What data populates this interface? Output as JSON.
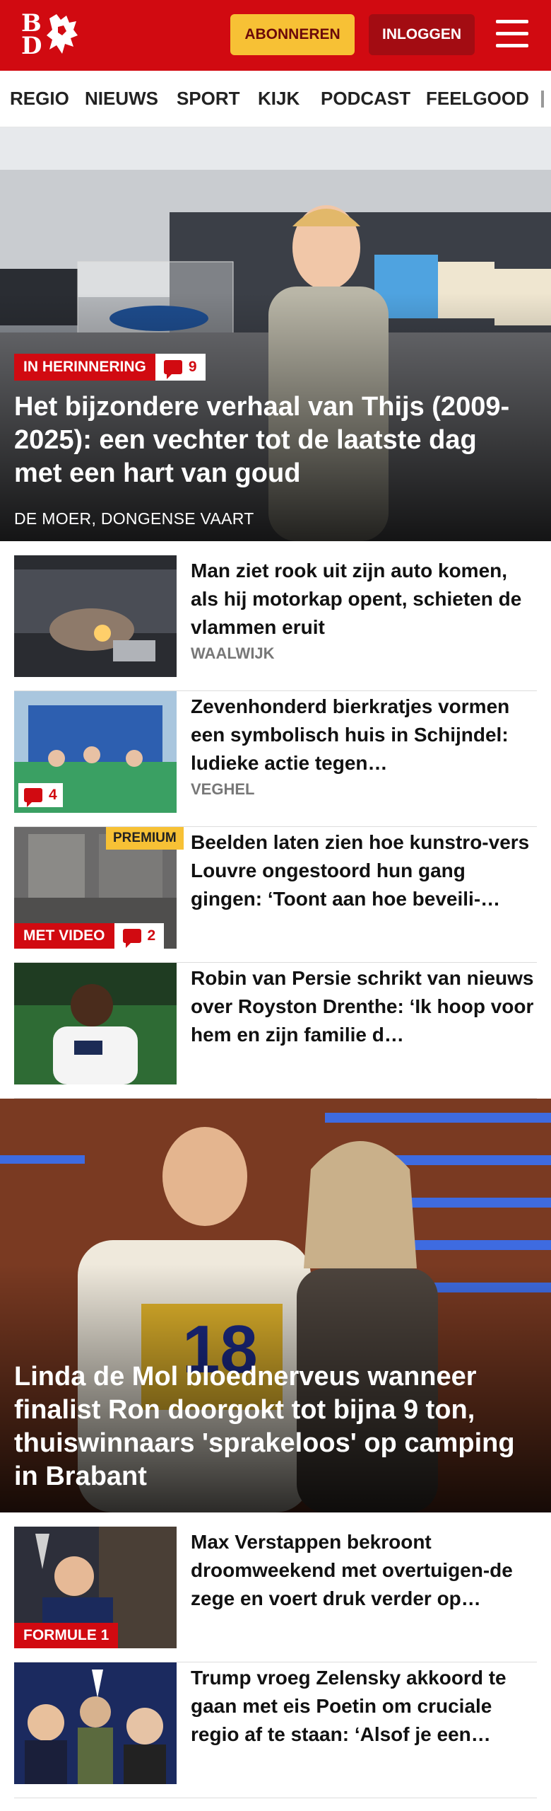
{
  "header": {
    "logo_top": "B",
    "logo_bottom": "D",
    "subscribe_label": "ABONNEREN",
    "login_label": "INLOGGEN"
  },
  "nav": {
    "items": [
      "REGIO",
      "NIEUWS",
      "SPORT",
      "KIJK",
      "PODCAST",
      "FEELGOOD"
    ]
  },
  "hero1": {
    "label": "IN HERINNERING",
    "comments": "9",
    "title": "Het bijzondere verhaal van Thijs (2009-2025): een vechter tot de laatste dag met een hart van goud",
    "location": "DE MOER, DONGENSE VAART"
  },
  "articles": [
    {
      "title": "Man ziet rook uit zijn auto komen, als hij motorkap opent, schieten de vlammen eruit",
      "location": "WAALWIJK"
    },
    {
      "title": "Zevenhonderd bierkratjes vormen een symbolisch huis in Schijndel: ludieke actie tegen…",
      "location": "VEGHEL",
      "comments": "4"
    },
    {
      "title": "Beelden laten zien hoe kunstro-vers Louvre ongestoord hun gang gingen: ‘Toont aan hoe beveili-…",
      "premium": "PREMIUM",
      "label": "MET VIDEO",
      "comments": "2"
    },
    {
      "title": "Robin van Persie schrikt van nieuws over Royston Drenthe: ‘Ik hoop voor hem en zijn familie d…"
    }
  ],
  "hero2": {
    "title": "Linda de Mol bloednerveus wanneer finalist Ron doorgokt tot bijna 9 ton, thuiswinnaars 'sprakeloos' op camping in Brabant",
    "podium_number": "18"
  },
  "articles2": [
    {
      "title": "Max Verstappen bekroont droomweekend met overtuigen-de zege en voert druk verder op…",
      "label": "FORMULE 1"
    },
    {
      "title": "Trump vroeg Zelensky akkoord te gaan met eis Poetin om cruciale regio af te staan: ‘Alsof je een…"
    }
  ],
  "colors": {
    "brand_red": "#d10a11",
    "subscribe_yellow": "#f7c135",
    "login_dark_red": "#a30c12"
  }
}
